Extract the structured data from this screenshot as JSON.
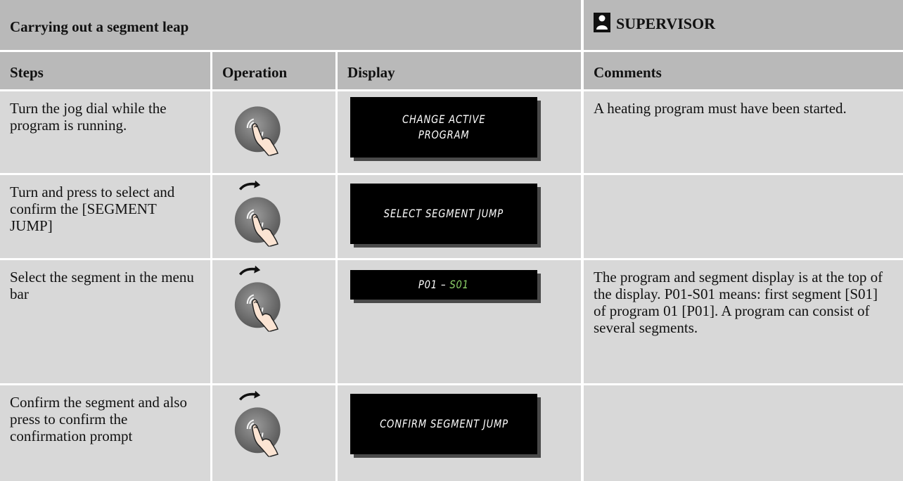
{
  "header": {
    "title": "Carrying out a segment leap",
    "role_label": "SUPERVISOR",
    "role_icon": "person-icon"
  },
  "columns": {
    "steps": "Steps",
    "operation": "Operation",
    "display": "Display",
    "comments": "Comments"
  },
  "rows": [
    {
      "step": "Turn the jog dial while the program is running.",
      "operation_icon": "jog-dial-press-icon",
      "display_text": "CHANGE ACTIVE\nPROGRAM",
      "comment": "A heating program must have been started."
    },
    {
      "step": "Turn and press to select and confirm the [SEGMENT JUMP]",
      "operation_icon": "jog-dial-turn-press-icon",
      "display_text": "SELECT SEGMENT JUMP",
      "comment": ""
    },
    {
      "step": "Select the segment in the menu bar",
      "operation_icon": "jog-dial-turn-press-icon",
      "display_text_prefix": "P01 – ",
      "display_text_highlight": "S01",
      "comment": "The program and segment display is at the top of the display. P01-S01 means: first segment [S01] of program 01 [P01]. A program can consist of several segments."
    },
    {
      "step": "Confirm the segment and also press to confirm the confirmation prompt",
      "operation_icon": "jog-dial-turn-press-icon",
      "display_text": "CONFIRM SEGMENT JUMP",
      "comment": ""
    }
  ],
  "colors": {
    "header_bg": "#b9b9b9",
    "cell_bg": "#d8d8d8",
    "lcd_bg": "#000000",
    "lcd_text": "#ffffff",
    "lcd_highlight": "#8ed36a"
  }
}
